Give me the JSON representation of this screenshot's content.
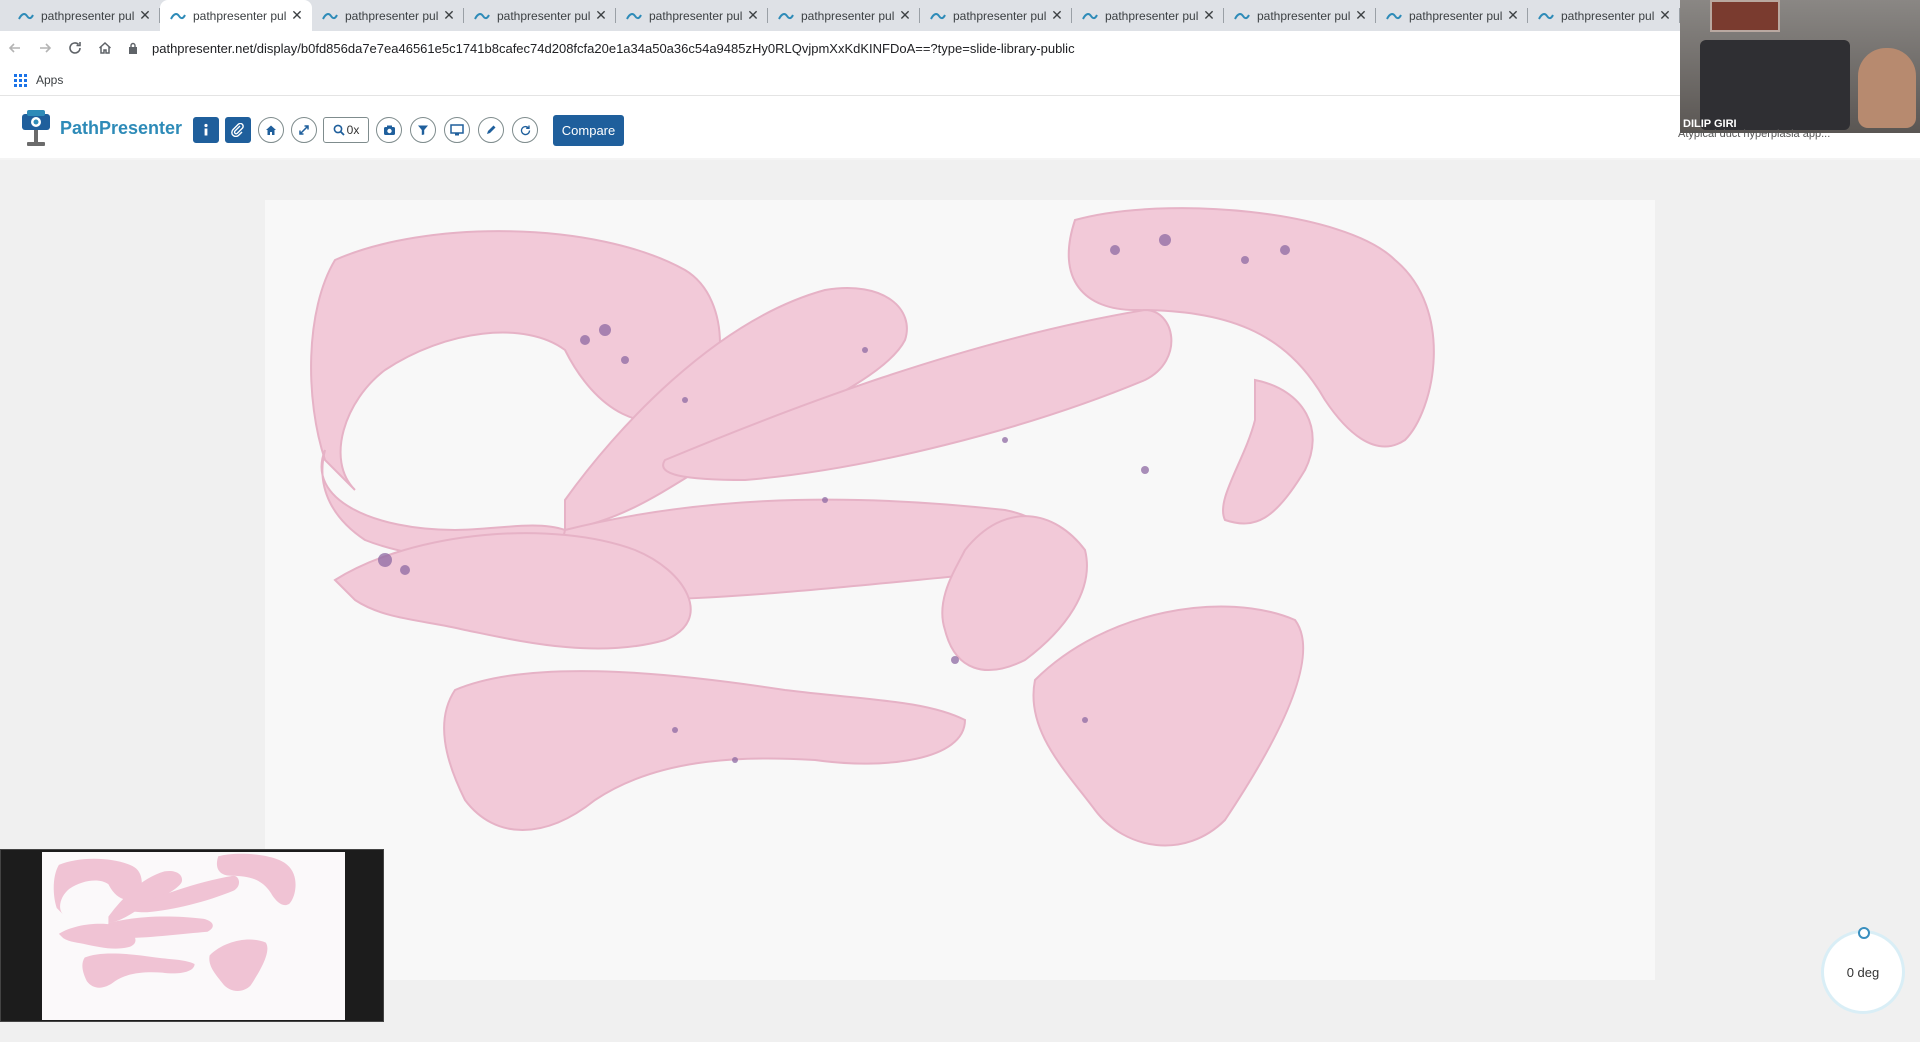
{
  "browser": {
    "tabs": [
      {
        "title": "pathpresenter pul",
        "active": false
      },
      {
        "title": "pathpresenter pul",
        "active": true
      },
      {
        "title": "pathpresenter pul",
        "active": false
      },
      {
        "title": "pathpresenter pul",
        "active": false
      },
      {
        "title": "pathpresenter pul",
        "active": false
      },
      {
        "title": "pathpresenter pul",
        "active": false
      },
      {
        "title": "pathpresenter pul",
        "active": false
      },
      {
        "title": "pathpresenter pul",
        "active": false
      },
      {
        "title": "pathpresenter pul",
        "active": false
      },
      {
        "title": "pathpresenter pul",
        "active": false
      },
      {
        "title": "pathpresenter pul",
        "active": false
      }
    ],
    "url": "pathpresenter.net/display/b0fd856da7e7ea46561e5c1741b8cafec74d208fcfa20e1a34a50a36c54a9485zHy0RLQvjpmXxKdKINFDoA==?type=slide-library-public",
    "bookmarks": {
      "apps_label": "Apps"
    }
  },
  "app": {
    "name": "PathPresenter",
    "brand_color": "#2e8bb8",
    "accent_color": "#1f5f9c",
    "toolbar": {
      "tools": [
        {
          "icon": "info-icon"
        },
        {
          "icon": "paperclip-icon"
        },
        {
          "icon": "home-icon"
        },
        {
          "icon": "fullscreen-icon"
        },
        {
          "icon": "zoom-icon",
          "label": "0x"
        },
        {
          "icon": "camera-icon"
        },
        {
          "icon": "filter-icon"
        },
        {
          "icon": "monitor-icon"
        },
        {
          "icon": "pencil-icon"
        },
        {
          "icon": "rotate-icon"
        }
      ],
      "compare_label": "Compare"
    }
  },
  "video": {
    "participant": "DILIP GIRI",
    "caption": "Atypical duct hyperplasia app..."
  },
  "viewer": {
    "rotation_label": "0 deg"
  }
}
